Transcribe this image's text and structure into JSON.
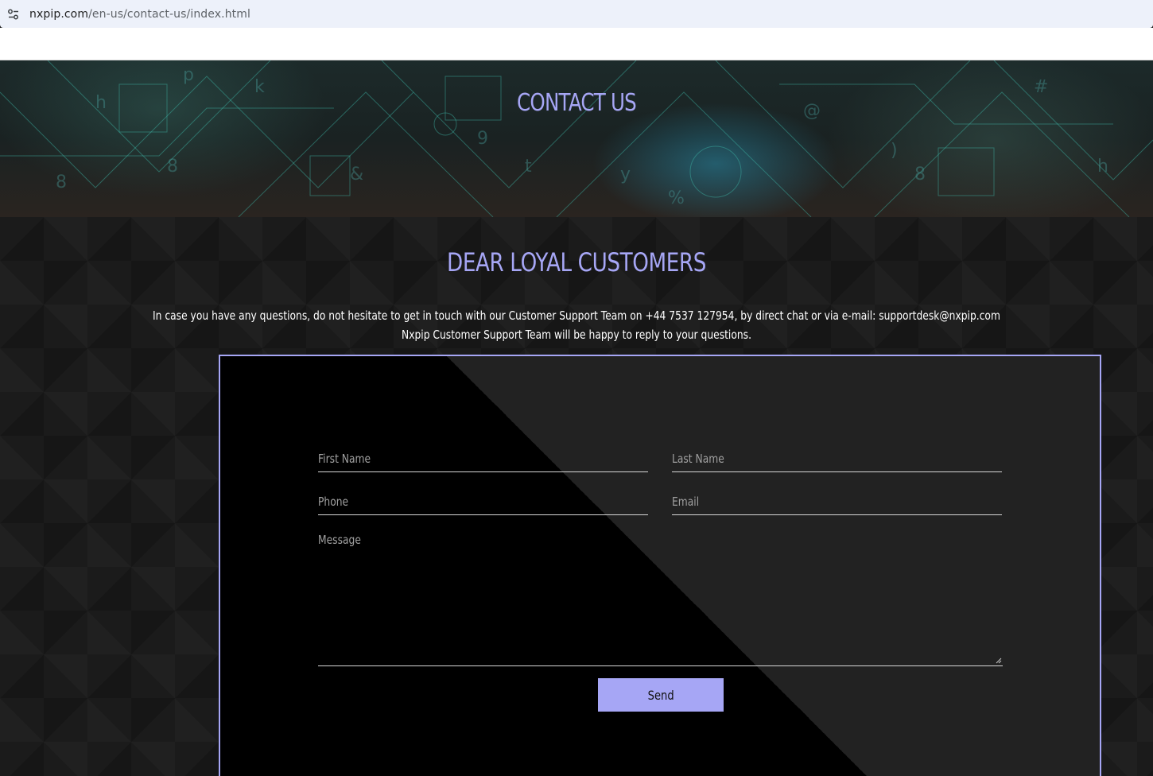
{
  "browser": {
    "url_host": "nxpip.com",
    "url_path": "/en-us/contact-us/index.html",
    "site_info_icon": "tune-icon"
  },
  "hero": {
    "title": "CONTACT US"
  },
  "main": {
    "title": "DEAR LOYAL CUSTOMERS",
    "intro_line1": "In case you have any questions, do not hesitate to get in touch with our Customer Support Team on +44 7537 127954, by direct chat or via e-mail: supportdesk@nxpip.com",
    "intro_line2": "Nxpip Customer Support Team will be happy to reply to your questions."
  },
  "form": {
    "first_name_placeholder": "First Name",
    "last_name_placeholder": "Last Name",
    "phone_placeholder": "Phone",
    "email_placeholder": "Email",
    "message_placeholder": "Message",
    "send_label": "Send"
  },
  "colors": {
    "accent": "#a6a6f5",
    "card_dark": "#000000",
    "card_light": "#222222",
    "page_bg": "#1b1b1b"
  }
}
